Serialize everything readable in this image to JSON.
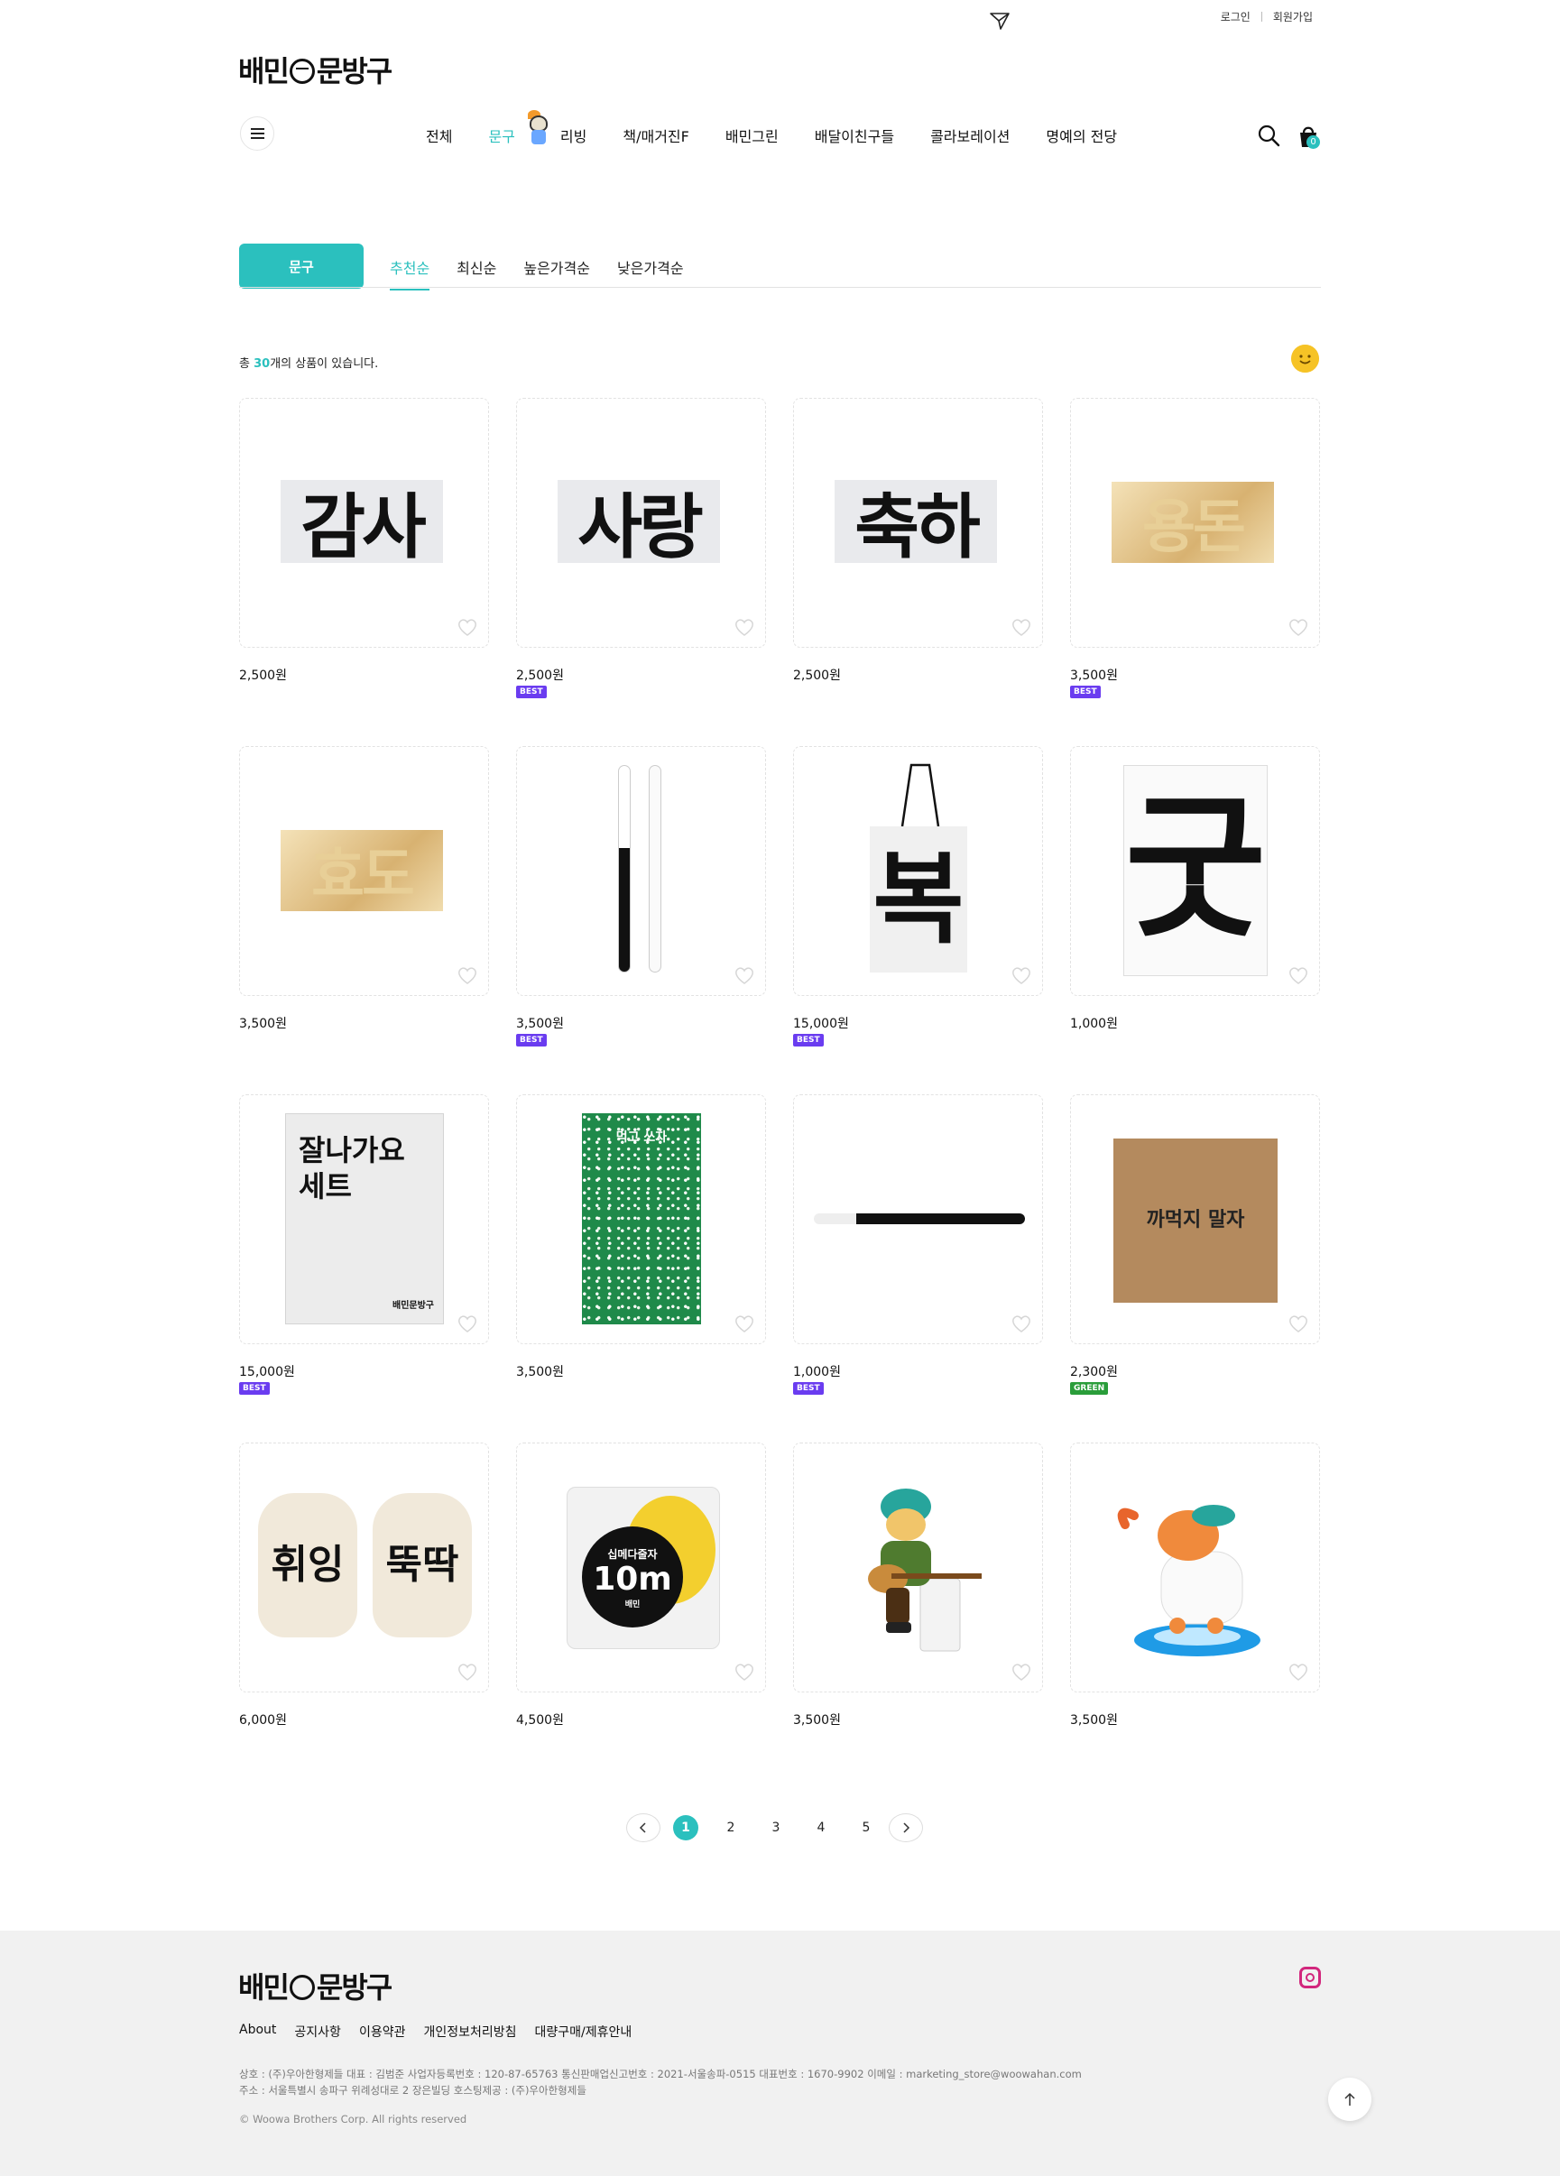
{
  "util": {
    "login": "로그인",
    "signup": "회원가입"
  },
  "logo": {
    "part1": "배민",
    "part2": "문방구"
  },
  "nav": {
    "items": [
      "전체",
      "문구",
      "리빙",
      "책/매거진F",
      "배민그린",
      "배달이친구들",
      "콜라보레이션",
      "명예의 전당"
    ],
    "cart_count": "0"
  },
  "category": {
    "label": "문구"
  },
  "sorts": [
    "추천순",
    "최신순",
    "높은가격순",
    "낮은가격순"
  ],
  "count": {
    "prefix": "총",
    "number": "30",
    "suffix": "개의 상품이 있습니다."
  },
  "products": [
    {
      "price": "2,500원",
      "badge": "",
      "art": "감사"
    },
    {
      "price": "2,500원",
      "badge": "BEST",
      "art": "사랑"
    },
    {
      "price": "2,500원",
      "badge": "",
      "art": "축하"
    },
    {
      "price": "3,500원",
      "badge": "BEST",
      "art": "용돈"
    },
    {
      "price": "3,500원",
      "badge": "",
      "art": "효도"
    },
    {
      "price": "3,500원",
      "badge": "BEST",
      "art": "pens"
    },
    {
      "price": "15,000원",
      "badge": "BEST",
      "art": "복"
    },
    {
      "price": "1,000원",
      "badge": "",
      "art": "굿"
    },
    {
      "price": "15,000원",
      "badge": "BEST",
      "art": "잘나가요 세트"
    },
    {
      "price": "3,500원",
      "badge": "",
      "art": "먹고 쓰자"
    },
    {
      "price": "1,000원",
      "badge": "BEST",
      "art": "pen"
    },
    {
      "price": "2,300원",
      "badge": "GREEN",
      "art": "까먹지 말자"
    },
    {
      "price": "6,000원",
      "badge": "",
      "art": "gloves"
    },
    {
      "price": "4,500원",
      "badge": "",
      "art": "십미터줄자"
    },
    {
      "price": "3,500원",
      "badge": "",
      "art": "figure1"
    },
    {
      "price": "3,500원",
      "badge": "",
      "art": "figure2"
    }
  ],
  "product_art_text": {
    "gamsa": "감사",
    "sarang": "사랑",
    "chukha": "축하",
    "yongdon": "용돈",
    "hyodo": "효도",
    "bok": "복",
    "gut": "굿",
    "set_line1": "잘나가요",
    "set_line2": "세트",
    "set_brand": "배민문방구",
    "notebook": "먹고 쓰자",
    "box": "까먹지 말자",
    "glove_left": "휘잉",
    "glove_right": "뚝딱",
    "tape_title": "십메다줄자",
    "tape_size": "10m",
    "tape_brand": "배민"
  },
  "pagination": {
    "pages": [
      "1",
      "2",
      "3",
      "4",
      "5"
    ],
    "current": "1"
  },
  "footer": {
    "links": [
      "About",
      "공지사항",
      "이용약관",
      "개인정보처리방침",
      "대량구매/제휴안내"
    ],
    "info_line1": "상호 : (주)우아한형제들    대표 : 김범준    사업자등록번호 : 120-87-65763    통신판매업신고번호 : 2021-서울송파-0515    대표번호 : 1670-9902    이메일 : marketing_store@woowahan.com",
    "info_line2": "주소 : 서울특별시 송파구 위례성대로 2 장은빌딩    호스팅제공 : (주)우아한형제들",
    "copyright": "© Woowa Brothers Corp. All rights reserved"
  },
  "colors": {
    "accent": "#2bc0be",
    "best": "#6a3cf0",
    "green": "#2a9d3a"
  }
}
